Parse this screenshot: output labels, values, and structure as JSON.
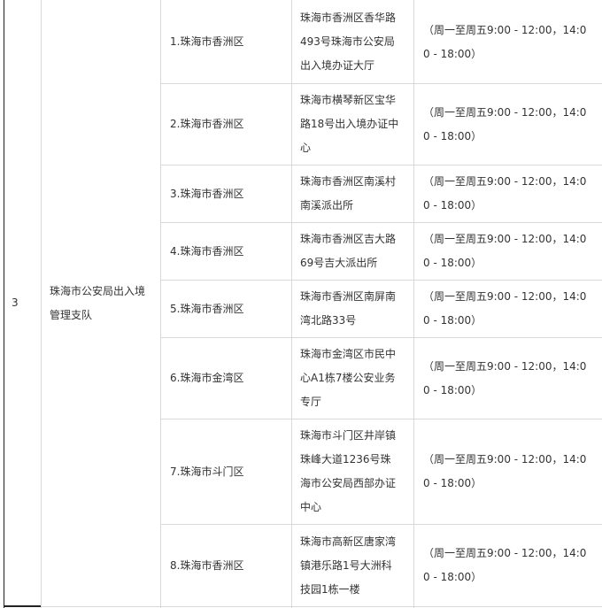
{
  "row_index": "3",
  "organization": "珠海市公安局出入境\n管理支队",
  "offices": [
    {
      "area": "1.珠海市香洲区",
      "address": "珠海市香洲区香华路\n493号珠海市公安局\n出入境办证大厅",
      "hours": "（周一至周五9:00 - 12:00，14:0\n0 - 18:00）"
    },
    {
      "area": "2.珠海市香洲区",
      "address": "珠海市横琴新区宝华\n路18号出入境办证中\n心",
      "hours": "（周一至周五9:00 - 12:00，14:0\n0 - 18:00）"
    },
    {
      "area": "3.珠海市香洲区",
      "address": "珠海市香洲区南溪村\n南溪派出所",
      "hours": "（周一至周五9:00 - 12:00，14:0\n0 - 18:00）"
    },
    {
      "area": "4.珠海市香洲区",
      "address": "珠海市香洲区吉大路\n69号吉大派出所",
      "hours": "（周一至周五9:00 - 12:00，14:0\n0 - 18:00）"
    },
    {
      "area": "5.珠海市香洲区",
      "address": "珠海市香洲区南屏南\n湾北路33号",
      "hours": "（周一至周五9:00 - 12:00，14:0\n0 - 18:00）"
    },
    {
      "area": "6.珠海市金湾区",
      "address": "珠海市金湾区市民中\n心A1栋7楼公安业务\n专厅",
      "hours": "（周一至周五9:00 - 12:00，14:0\n0 - 18:00）"
    },
    {
      "area": "7.珠海市斗门区",
      "address": "珠海市斗门区井岸镇\n珠峰大道1236号珠\n海市公安局西部办证\n中心",
      "hours": "（周一至周五9:00 - 12:00，14:0\n0 - 18:00）"
    },
    {
      "area": "8.珠海市香洲区",
      "address": "珠海市高新区唐家湾\n镇港乐路1号大洲科\n技园1栋一楼",
      "hours": "（周一至周五9:00 - 12:00，14:0\n0 - 18:00）"
    }
  ]
}
